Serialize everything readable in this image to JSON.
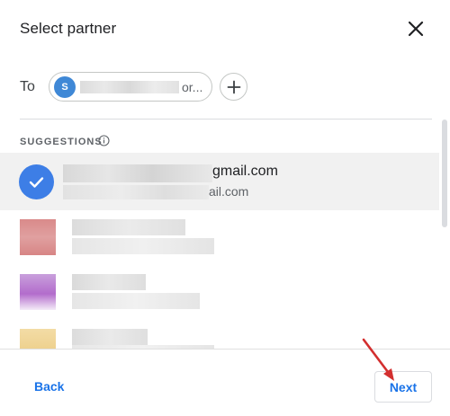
{
  "dialog": {
    "title": "Select partner",
    "close_icon": "close-icon"
  },
  "recipient": {
    "to_label": "To",
    "chip_initial": "S",
    "chip_visible_suffix": "or...",
    "add_icon": "plus-icon"
  },
  "suggestions": {
    "label": "SUGGESTIONS",
    "info_icon": "info-icon",
    "selected": {
      "primary_visible": "gmail.com",
      "secondary_visible": "ail.com",
      "check_icon": "checkmark-icon"
    }
  },
  "footer": {
    "back_label": "Back",
    "next_label": "Next"
  },
  "colors": {
    "accent": "#1a73e8",
    "avatar_blue": "#3f88d6",
    "selected_check_bg": "#3d7ee6",
    "selected_row_bg": "#f1f1f1",
    "annotation_arrow": "#d32f2f"
  }
}
